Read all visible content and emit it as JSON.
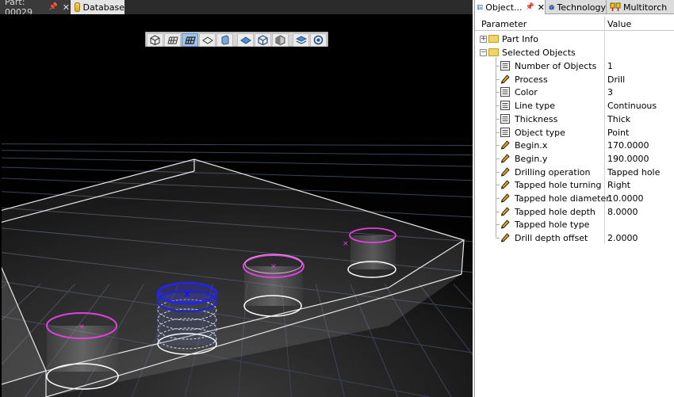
{
  "left_panel": {
    "tabs": [
      {
        "label": "Part: 00029",
        "pinned": true,
        "closable": true
      },
      {
        "label": "Database"
      }
    ]
  },
  "view_toolbar": {
    "buttons": [
      "isometric-view-icon",
      "wireframe-view-icon",
      "grid-view-icon",
      "front-view-icon",
      "shaded-view-icon",
      "top-view-icon",
      "box-view-icon",
      "side-view-icon",
      "layers-view-icon",
      "rotate-view-icon"
    ]
  },
  "right_panel": {
    "tabs": [
      {
        "label": "Object...",
        "icon": "object-list-icon",
        "active": true
      },
      {
        "label": "Technology",
        "icon": "technology-icon"
      },
      {
        "label": "Multitorch",
        "icon": "multitorch-icon"
      }
    ],
    "grid": {
      "header_parameter": "Parameter",
      "header_value": "Value",
      "groups": [
        {
          "label": "Part Info",
          "expanded": false,
          "expander": "+"
        },
        {
          "label": "Selected Objects",
          "expanded": true,
          "expander": "−"
        }
      ],
      "rows": [
        {
          "name": "Number of Objects",
          "value": "1",
          "icon": "readonly-icon"
        },
        {
          "name": "Process",
          "value": "Drill",
          "icon": "pencil-icon"
        },
        {
          "name": "Color",
          "value": "3",
          "icon": "readonly-icon"
        },
        {
          "name": "Line type",
          "value": "Continuous",
          "icon": "readonly-icon"
        },
        {
          "name": "Thickness",
          "value": "Thick",
          "icon": "readonly-icon"
        },
        {
          "name": "Object type",
          "value": "Point",
          "icon": "readonly-icon"
        },
        {
          "name": "Begin.x",
          "value": "170.0000",
          "icon": "pencil-icon"
        },
        {
          "name": "Begin.y",
          "value": "190.0000",
          "icon": "pencil-icon"
        },
        {
          "name": "Drilling operation",
          "value": "Tapped hole",
          "icon": "pencil-icon"
        },
        {
          "name": "Tapped hole turning",
          "value": "Right",
          "icon": "pencil-icon"
        },
        {
          "name": "Tapped hole diameter",
          "value": "10.0000",
          "icon": "pencil-icon"
        },
        {
          "name": "Tapped hole depth",
          "value": "8.0000",
          "icon": "pencil-icon"
        },
        {
          "name": "Tapped hole type",
          "value": "",
          "icon": "pencil-icon"
        },
        {
          "name": "Drill depth offset",
          "value": "2.0000",
          "icon": "pencil-icon"
        }
      ]
    }
  },
  "colors": {
    "viewport_bg": "#000000",
    "grid_line": "#3c4256",
    "part_edge": "#e8e8e8",
    "hole_unselected": "#e040e0",
    "hole_selected": "#2020e0",
    "panel_bg": "#ffffff"
  }
}
